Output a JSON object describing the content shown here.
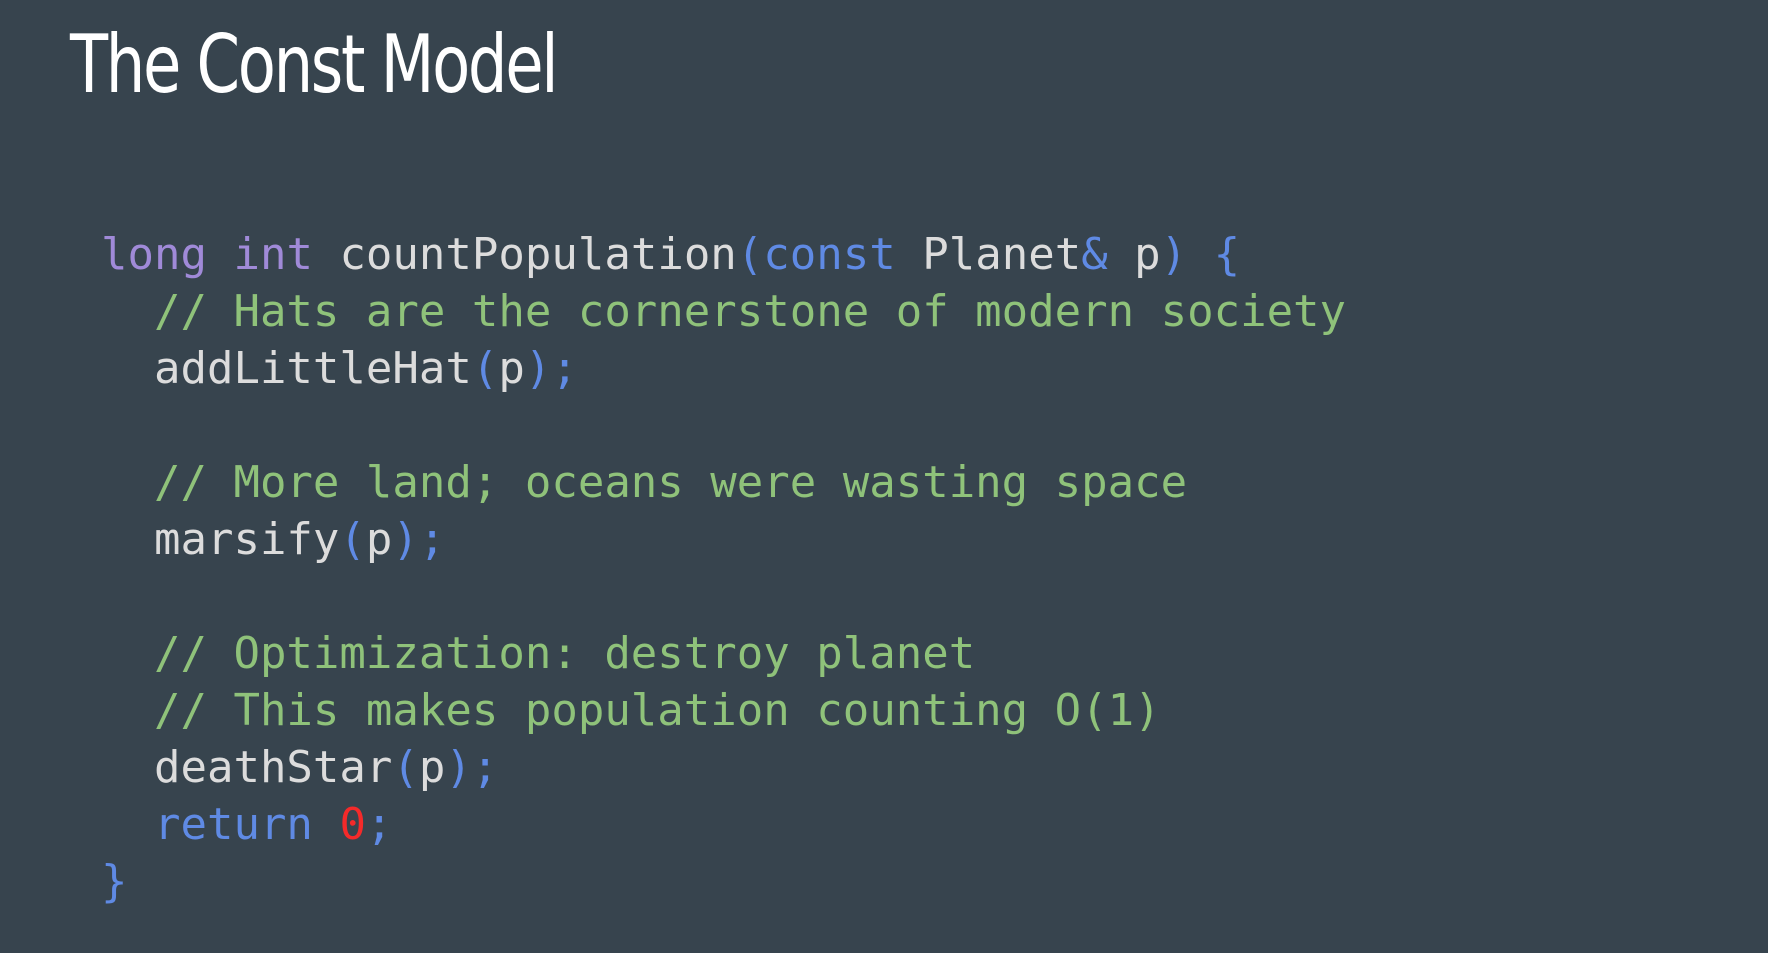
{
  "slide": {
    "title": "The Const Model"
  },
  "code": {
    "lines": [
      [
        {
          "t": "long",
          "k": "type"
        },
        {
          "t": " ",
          "k": "plain"
        },
        {
          "t": "int",
          "k": "type"
        },
        {
          "t": " countPopulation",
          "k": "plain"
        },
        {
          "t": "(",
          "k": "punc"
        },
        {
          "t": "const",
          "k": "kw"
        },
        {
          "t": " Planet",
          "k": "plain"
        },
        {
          "t": "&",
          "k": "punc"
        },
        {
          "t": " p",
          "k": "plain"
        },
        {
          "t": ")",
          "k": "punc"
        },
        {
          "t": " ",
          "k": "plain"
        },
        {
          "t": "{",
          "k": "punc"
        }
      ],
      [
        {
          "t": "  // Hats are the cornerstone of modern society",
          "k": "comment"
        }
      ],
      [
        {
          "t": "  addLittleHat",
          "k": "plain"
        },
        {
          "t": "(",
          "k": "punc"
        },
        {
          "t": "p",
          "k": "plain"
        },
        {
          "t": ");",
          "k": "punc"
        }
      ],
      [],
      [
        {
          "t": "  // More land; oceans were wasting space",
          "k": "comment"
        }
      ],
      [
        {
          "t": "  marsify",
          "k": "plain"
        },
        {
          "t": "(",
          "k": "punc"
        },
        {
          "t": "p",
          "k": "plain"
        },
        {
          "t": ");",
          "k": "punc"
        }
      ],
      [],
      [
        {
          "t": "  // Optimization: destroy planet",
          "k": "comment"
        }
      ],
      [
        {
          "t": "  // This makes population counting O(1)",
          "k": "comment"
        }
      ],
      [
        {
          "t": "  deathStar",
          "k": "plain"
        },
        {
          "t": "(",
          "k": "punc"
        },
        {
          "t": "p",
          "k": "plain"
        },
        {
          "t": ");",
          "k": "punc"
        }
      ],
      [
        {
          "t": "  ",
          "k": "plain"
        },
        {
          "t": "return",
          "k": "kw"
        },
        {
          "t": " ",
          "k": "plain"
        },
        {
          "t": "0",
          "k": "num"
        },
        {
          "t": ";",
          "k": "punc"
        }
      ],
      [
        {
          "t": "}",
          "k": "punc"
        }
      ]
    ]
  }
}
